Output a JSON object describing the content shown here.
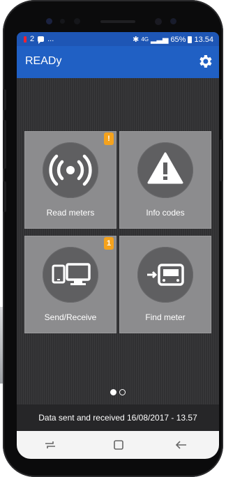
{
  "status_bar": {
    "left_text": "2",
    "ellipsis": "...",
    "network": "4G",
    "battery": "65%",
    "time": "13.54"
  },
  "app_bar": {
    "title": "READy",
    "settings_icon": "gear-icon"
  },
  "tiles": [
    {
      "label": "Read meters",
      "icon": "broadcast-icon",
      "badge": "!"
    },
    {
      "label": "Info codes",
      "icon": "warning-icon",
      "badge": ""
    },
    {
      "label": "Send/Receive",
      "icon": "devices-icon",
      "badge": "1"
    },
    {
      "label": "Find meter",
      "icon": "find-meter-icon",
      "badge": ""
    }
  ],
  "pager": {
    "count": 2,
    "active": 0
  },
  "footer": {
    "text": "Data sent and received 16/08/2017 - 13.57"
  },
  "colors": {
    "app_bar": "#2060c4",
    "status_bar": "#1e56b5",
    "tile": "#8c8c8e",
    "badge": "#f5a21c"
  }
}
